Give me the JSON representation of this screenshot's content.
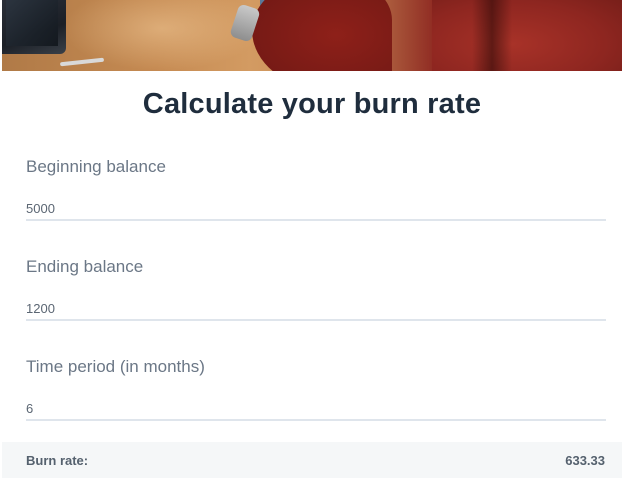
{
  "hero": {
    "description_icon": "office-photo"
  },
  "heading": {
    "title": "Calculate your burn rate"
  },
  "form": {
    "beginning_balance": {
      "label": "Beginning balance",
      "value": "5000"
    },
    "ending_balance": {
      "label": "Ending balance",
      "value": "1200"
    },
    "time_period": {
      "label": "Time period (in months)",
      "value": "6"
    }
  },
  "result": {
    "label": "Burn rate:",
    "value": "633.33"
  },
  "colors": {
    "title": "#1f2d3d",
    "label": "#6b7786",
    "underline": "#dfe5ec",
    "result_bg": "#f5f7f8",
    "result_text": "#55616e"
  }
}
